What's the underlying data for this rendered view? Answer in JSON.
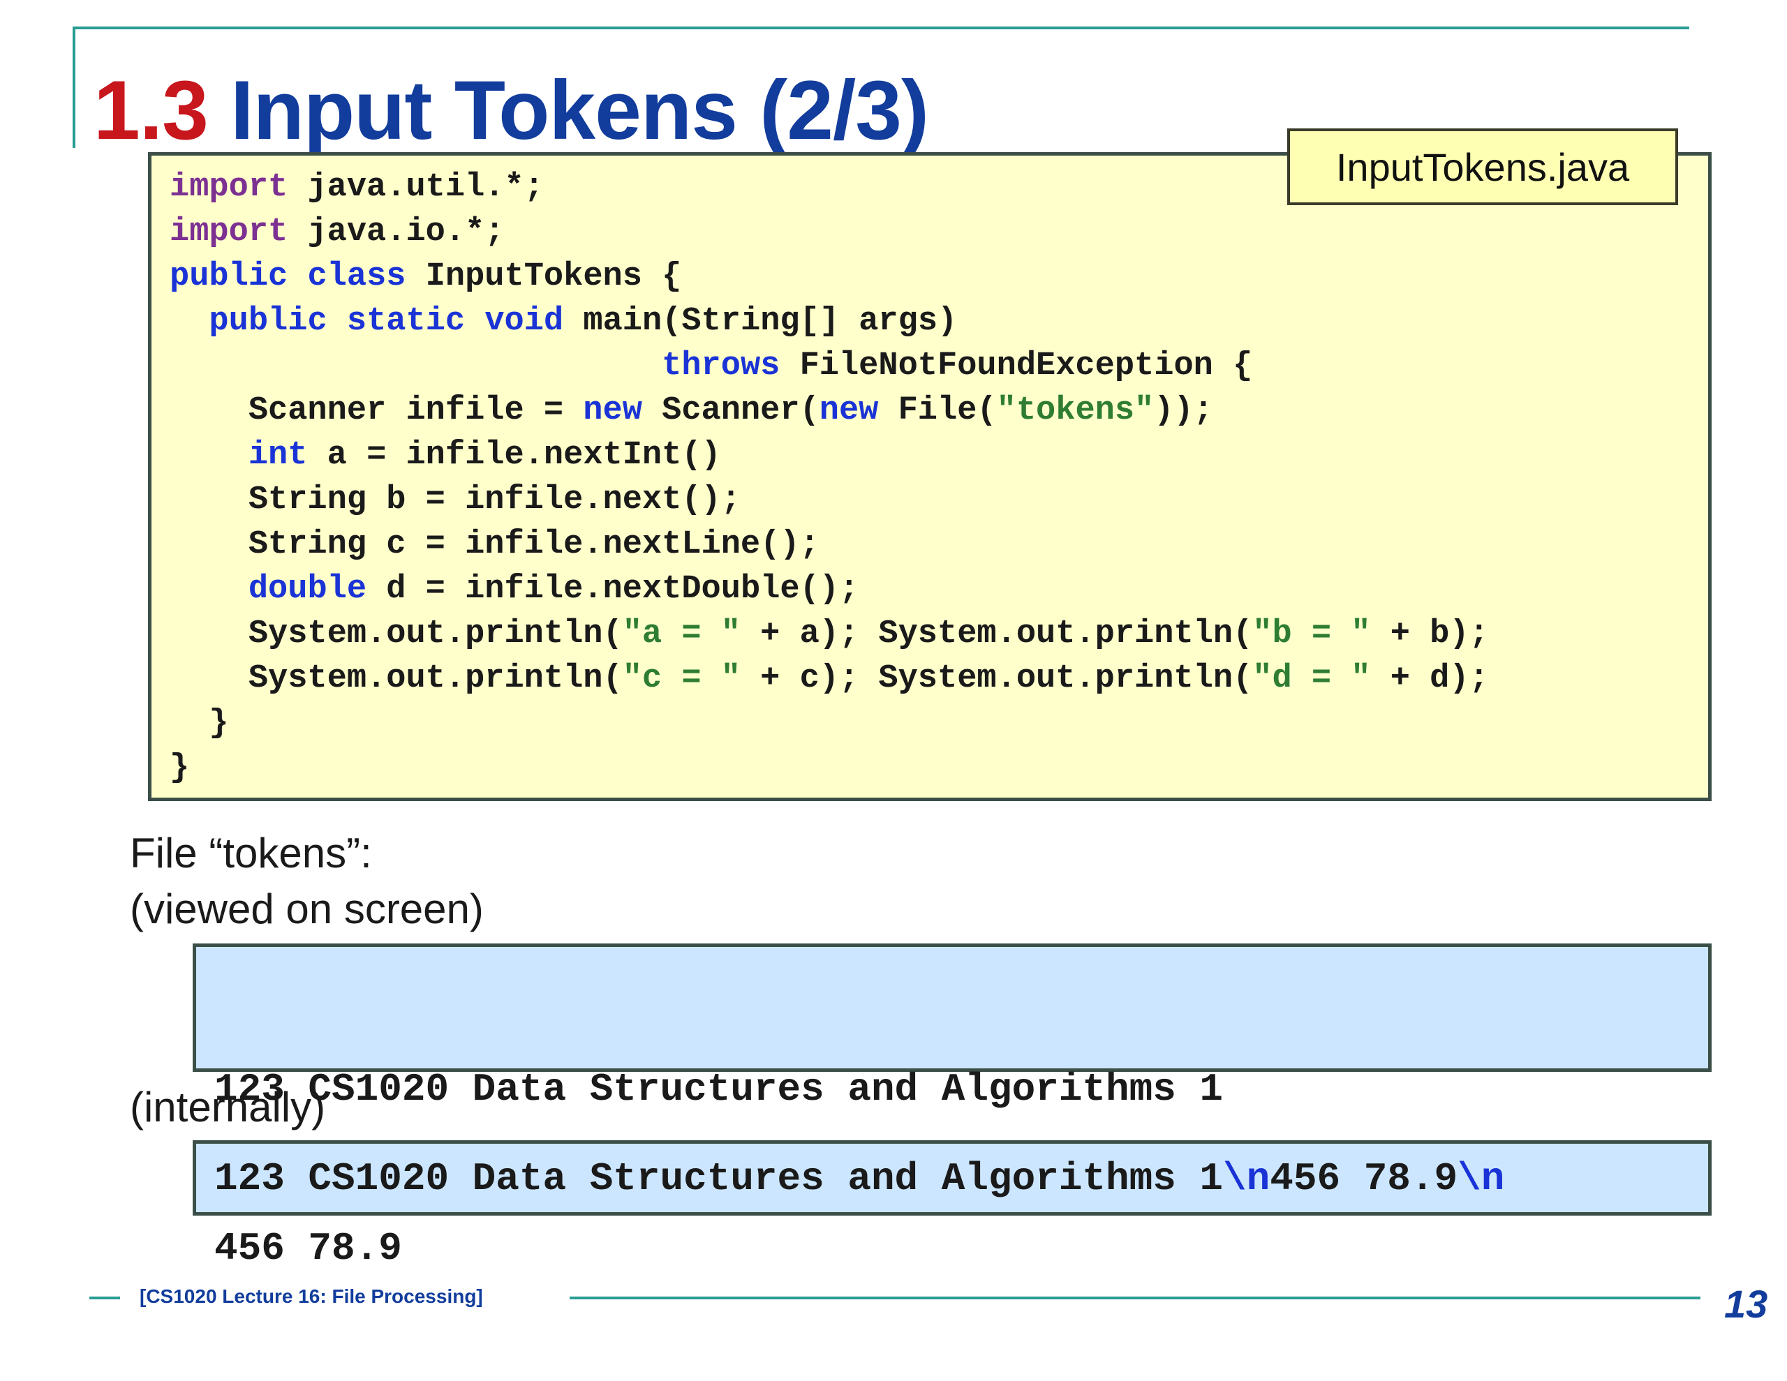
{
  "title": {
    "number": "1.3",
    "text": "Input Tokens (2/3)"
  },
  "file_label": "InputTokens.java",
  "code": [
    [
      {
        "t": "import",
        "c": "kw-p"
      },
      {
        "t": " java.util.*;"
      }
    ],
    [
      {
        "t": "import",
        "c": "kw-p"
      },
      {
        "t": " java.io.*;"
      }
    ],
    [
      {
        "t": "public",
        "c": "kw-b"
      },
      {
        "t": " "
      },
      {
        "t": "class",
        "c": "kw-b"
      },
      {
        "t": " InputTokens {"
      }
    ],
    [
      {
        "t": "  "
      },
      {
        "t": "public",
        "c": "kw-b"
      },
      {
        "t": " "
      },
      {
        "t": "static",
        "c": "kw-b"
      },
      {
        "t": " "
      },
      {
        "t": "void",
        "c": "kw-b"
      },
      {
        "t": " main(String[] args)"
      }
    ],
    [
      {
        "t": "                         "
      },
      {
        "t": "throws",
        "c": "kw-b"
      },
      {
        "t": " FileNotFoundException {"
      }
    ],
    [
      {
        "t": "    Scanner infile = "
      },
      {
        "t": "new",
        "c": "kw-b"
      },
      {
        "t": " Scanner("
      },
      {
        "t": "new",
        "c": "kw-b"
      },
      {
        "t": " File("
      },
      {
        "t": "\"tokens\"",
        "c": "str"
      },
      {
        "t": "));"
      }
    ],
    [
      {
        "t": "    "
      },
      {
        "t": "int",
        "c": "kw-b"
      },
      {
        "t": " a = infile.nextInt()"
      }
    ],
    [
      {
        "t": "    String b = infile.next();"
      }
    ],
    [
      {
        "t": "    String c = infile.nextLine();"
      }
    ],
    [
      {
        "t": "    "
      },
      {
        "t": "double",
        "c": "kw-b"
      },
      {
        "t": " d = infile.nextDouble();"
      }
    ],
    [
      {
        "t": "    System.out.println("
      },
      {
        "t": "\"a = \"",
        "c": "str"
      },
      {
        "t": " + a); System.out.println("
      },
      {
        "t": "\"b = \"",
        "c": "str"
      },
      {
        "t": " + b);"
      }
    ],
    [
      {
        "t": "    System.out.println("
      },
      {
        "t": "\"c = \"",
        "c": "str"
      },
      {
        "t": " + c); System.out.println("
      },
      {
        "t": "\"d = \"",
        "c": "str"
      },
      {
        "t": " + d);"
      }
    ],
    [
      {
        "t": "  }"
      }
    ],
    [
      {
        "t": "}"
      }
    ]
  ],
  "captions": {
    "file": "File “tokens”:",
    "viewed": "(viewed on screen)",
    "internally": "(internally)"
  },
  "screen_view": [
    "123 CS1020 Data Structures and Algorithms 1",
    "456 78.9"
  ],
  "internal_view": [
    {
      "t": "123 CS1020 Data Structures and Algorithms 1"
    },
    {
      "t": "\\n",
      "c": "esc"
    },
    {
      "t": "456 78.9"
    },
    {
      "t": "\\n",
      "c": "esc"
    }
  ],
  "footer": {
    "course": "[CS1020 Lecture 16: File Processing]",
    "page": "13"
  },
  "colors": {
    "title_number": "#c8161d",
    "title_text": "#123d9c",
    "code_background": "#ffffcc",
    "data_box_background": "#cce6ff",
    "keyword_purple": "#7c3092",
    "keyword_blue": "#1a33d6",
    "string_green": "#2e7d32",
    "rule_teal": "#2a9d93"
  }
}
